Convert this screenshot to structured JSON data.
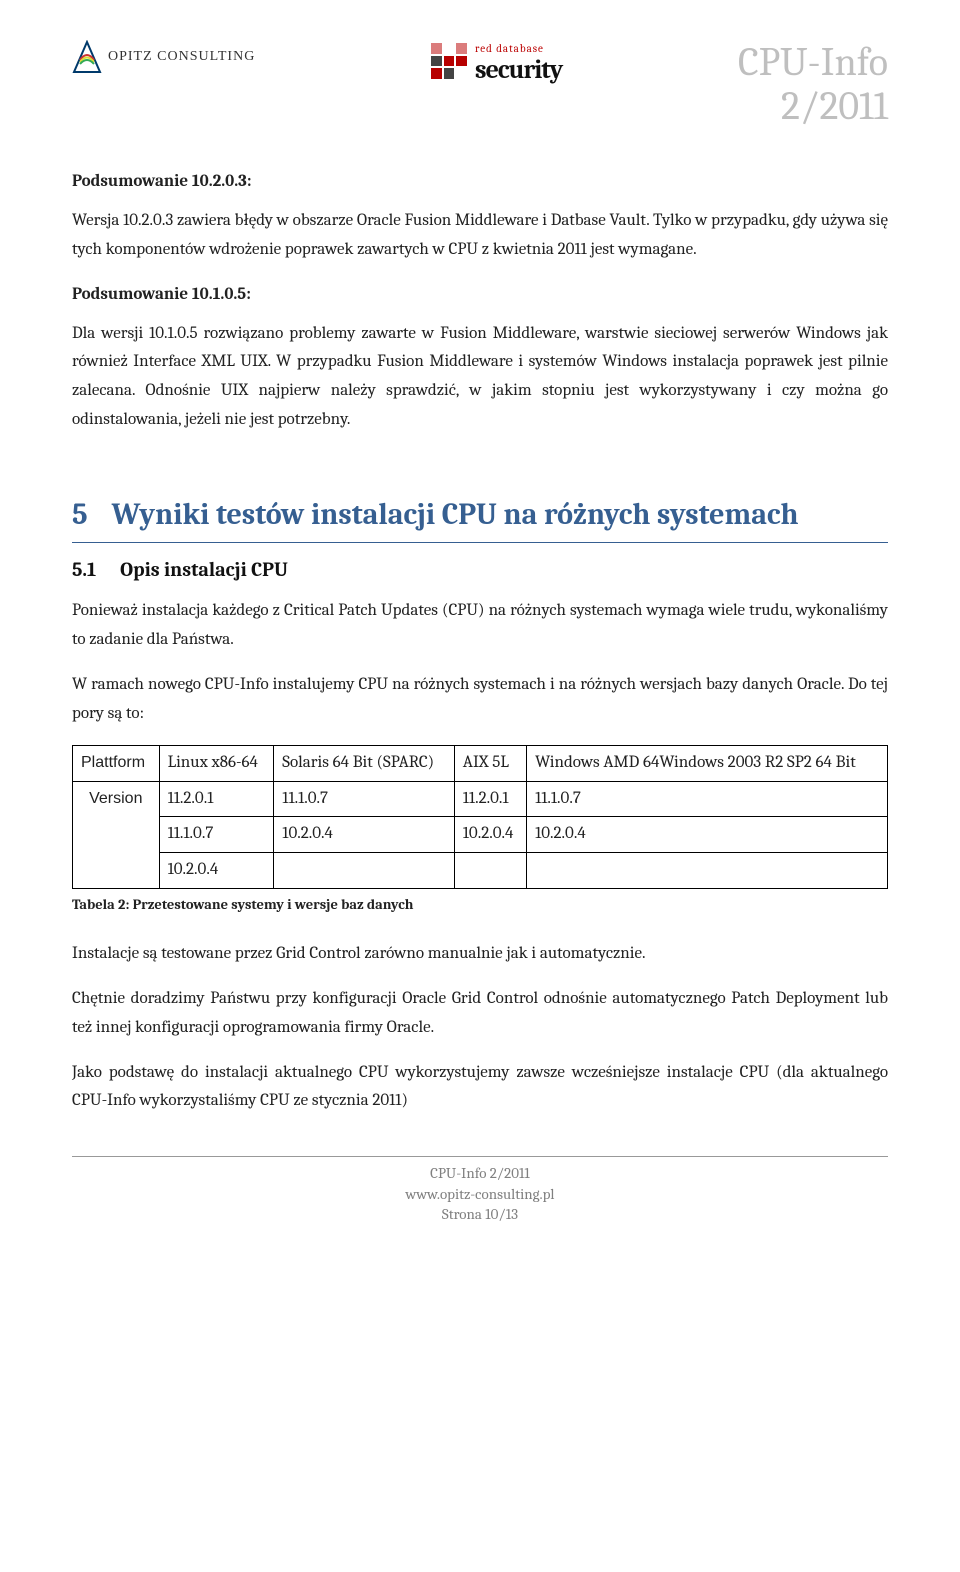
{
  "header": {
    "opitz_brand": "OPITZ CONSULTING",
    "rds_line1": "red database",
    "rds_line2": "security",
    "doc_title_line1": "CPU-Info",
    "doc_title_line2": "2/2011"
  },
  "section1": {
    "heading": "Podsumowanie 10.2.0.3:",
    "para1": "Wersja 10.2.0.3 zawiera błędy w obszarze Oracle Fusion Middleware i Datbase Vault. Tylko w przypadku, gdy używa się tych komponentów wdrożenie poprawek zawartych w CPU z kwietnia 2011 jest wymagane."
  },
  "section2": {
    "heading": "Podsumowanie 10.1.0.5:",
    "para1": "Dla wersji 10.1.0.5 rozwiązano problemy zawarte w Fusion Middleware, warstwie sieciowej serwerów Windows jak również Interface XML UIX.  W przypadku Fusion Middleware i systemów Windows instalacja poprawek jest pilnie zalecana. Odnośnie UIX najpierw należy sprawdzić, w jakim stopniu jest wykorzystywany i czy można go odinstalowania, jeżeli nie jest potrzebny."
  },
  "chapter5": {
    "num": "5",
    "title": "Wyniki testów instalacji CPU na różnych systemach",
    "sub_num": "5.1",
    "sub_title": "Opis instalacji CPU",
    "para1": "Ponieważ instalacja każdego z Critical Patch Updates (CPU) na różnych systemach wymaga wiele trudu, wykonaliśmy to zadanie dla Państwa.",
    "para2": "W ramach nowego CPU-Info instalujemy CPU na różnych systemach i na różnych wersjach bazy danych Oracle. Do tej pory są to:",
    "table": {
      "head": [
        "Plattform",
        "Linux x86-64",
        "Solaris 64 Bit (SPARC)",
        "AIX 5L",
        "Windows AMD 64Windows 2003 R2 SP2 64 Bit"
      ],
      "version_label": "Version",
      "rows": [
        [
          "11.2.0.1",
          "11.1.0.7",
          "11.2.0.1",
          "11.1.0.7"
        ],
        [
          "11.1.0.7",
          "10.2.0.4",
          "10.2.0.4",
          "10.2.0.4"
        ],
        [
          "10.2.0.4",
          "",
          "",
          ""
        ]
      ],
      "caption": "Tabela 2: Przetestowane systemy i wersje baz danych"
    },
    "para3": "Instalacje są testowane przez Grid Control zarówno manualnie jak i automatycznie.",
    "para4": "Chętnie doradzimy Państwu przy konfiguracji Oracle Grid Control odnośnie automatycznego Patch Deployment lub też innej konfiguracji oprogramowania firmy Oracle.",
    "para5": "Jako podstawę do instalacji aktualnego CPU wykorzystujemy zawsze wcześniejsze instalacje CPU (dla aktualnego CPU-Info wykorzystaliśmy CPU ze stycznia 2011)"
  },
  "footer": {
    "line1": "CPU-Info 2/2011",
    "line2": "www.opitz-consulting.pl",
    "line3": "Strona 10/13"
  }
}
